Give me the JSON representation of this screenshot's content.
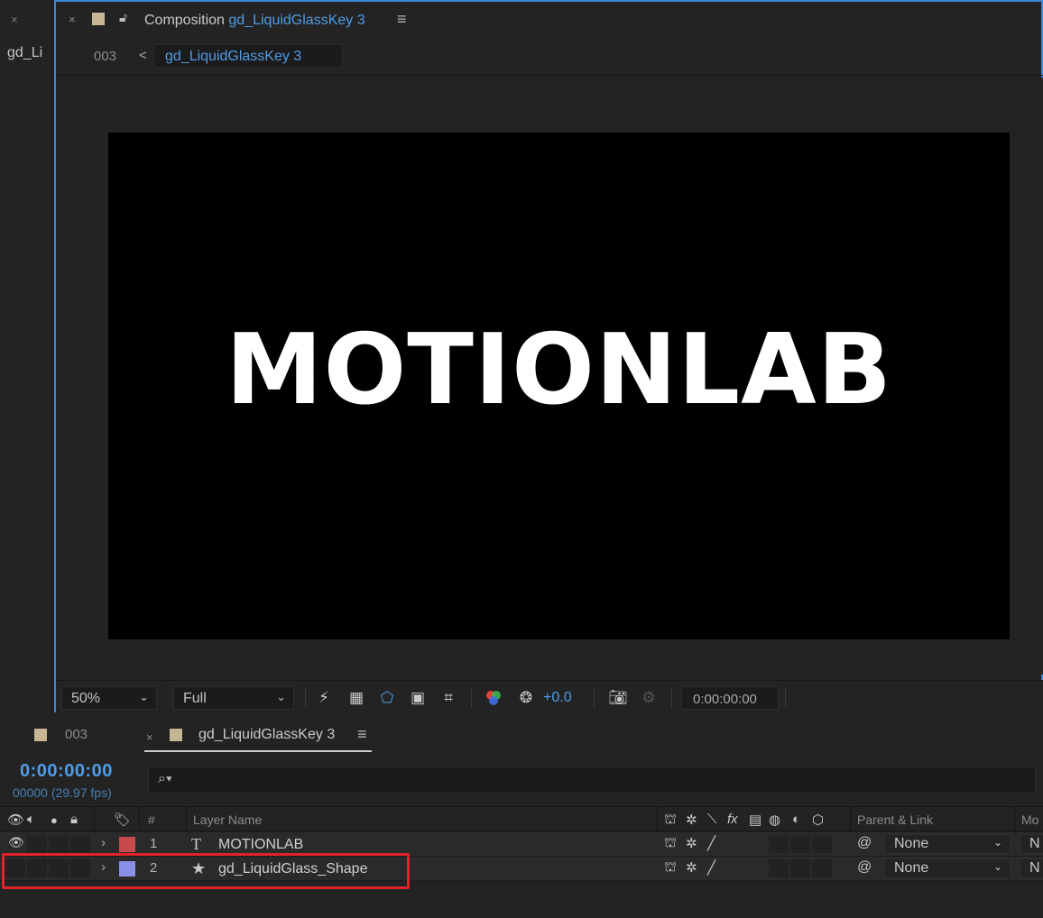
{
  "left_panel": {
    "close_glyph": "×",
    "tab_label": "gd_Li"
  },
  "comp_panel": {
    "close_glyph": "×",
    "title_prefix": "Composition",
    "comp_name": "gd_LiquidGlassKey 3",
    "menu_glyph": "≡",
    "breadcrumb_parent": "003",
    "breadcrumb_arrow": "<",
    "breadcrumb_current": "gd_LiquidGlassKey 3",
    "canvas_text": "MOTIONLAB",
    "footer": {
      "zoom": "50%",
      "resolution": "Full",
      "exposure": "+0.0",
      "timecode": "0:00:00:00"
    },
    "icons": [
      "fast-preview-icon",
      "transparency-grid-icon",
      "mask-visibility-icon",
      "region-of-interest-icon",
      "guides-icon",
      "channels-icon",
      "exposure-reset-icon",
      "snapshot-icon",
      "show-snapshot-icon"
    ]
  },
  "timeline": {
    "tab_inactive": "003",
    "tab_active_close": "×",
    "tab_active": "gd_LiquidGlassKey 3",
    "menu_glyph": "≡",
    "current_time": "0:00:00:00",
    "frame_info": "00000 (29.97 fps)",
    "search_icon": "⌕▾",
    "columns": {
      "number": "#",
      "layer_name": "Layer Name",
      "parent_link": "Parent & Link",
      "mode": "Mo"
    },
    "layers": [
      {
        "index": "1",
        "type_glyph": "T",
        "name": "MOTIONLAB",
        "label_color": "#c94a4a",
        "parent": "None",
        "mode": "N",
        "visible": true
      },
      {
        "index": "2",
        "type_glyph": "★",
        "name": "gd_LiquidGlass_Shape",
        "label_color": "#8a90e6",
        "parent": "None",
        "mode": "N",
        "visible": false
      }
    ]
  },
  "colors": {
    "accent_blue": "#4f9ce8",
    "highlight_red": "#e0232b",
    "swatch_tan": "#c7b593"
  }
}
